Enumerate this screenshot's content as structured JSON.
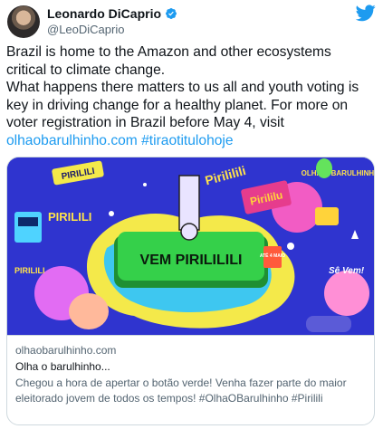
{
  "author": {
    "name": "Leonardo DiCaprio",
    "handle": "@LeoDiCaprio",
    "verified": true
  },
  "icons": {
    "brand": "twitter-bird-icon",
    "verified": "verified-badge-icon"
  },
  "colors": {
    "link": "#1d9bf0",
    "brand": "#1d9bf0",
    "card_background": "#2a2fc6",
    "button_green": "#35d04a"
  },
  "tweet": {
    "lines": [
      "Brazil is home to the Amazon and other ecosystems",
      "critical to climate change.",
      "What happens there matters to us all and youth voting is",
      "key in driving change for a healthy planet. For more on",
      "voter registration in Brazil before May 4, visit"
    ],
    "link_text": "olhaobarulhinho.com",
    "hashtag": "#tiraotitulohoje"
  },
  "card": {
    "image_text": {
      "main_button": "VEM PIRILILILI",
      "piriliii": "PIRILILI",
      "piriliii_left": "PIRILILI",
      "pirililu_top": "Pirililili",
      "pirililu_bottom": "Pirililu",
      "pirilili_small": "PIRILILI",
      "olha": "OLHA O BARULHINHO",
      "se_vem": "Sê Vem!",
      "ate_4_maio": "ATÉ 4 MAIO"
    },
    "domain": "olhaobarulhinho.com",
    "title": "Olha o barulhinho...",
    "description_lines": [
      "Chegou a hora de apertar o botão verde! Venha fazer parte do maior",
      "eleitorado jovem de todos os tempos! #OlhaOBarulhinho #Pirilili"
    ]
  }
}
